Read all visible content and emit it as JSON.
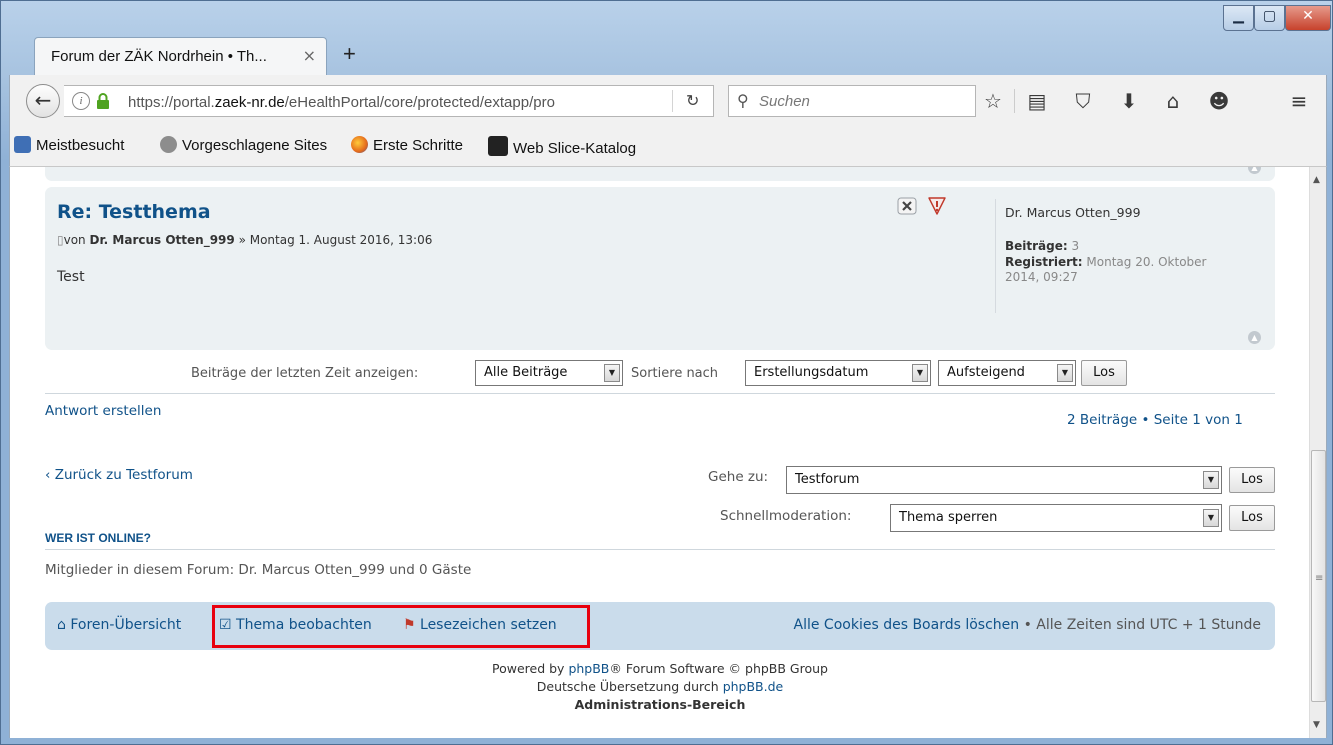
{
  "browser": {
    "tab_title": "Forum der ZÄK Nordrhein • Th...",
    "tab_close": "×",
    "new_tab": "+",
    "url_prefix": "https://portal.",
    "url_domain": "zaek-nr.de",
    "url_path": "/eHealthPortal/core/protected/extapp/pro",
    "search_placeholder": "Suchen",
    "window_buttons": {
      "minimize": "▁",
      "maximize": "▢",
      "close": "✕"
    }
  },
  "bookmarks": [
    {
      "label": "Meistbesucht",
      "icon": "most-visited-icon",
      "color": "#3f6fb5"
    },
    {
      "label": "Vorgeschlagene Sites",
      "icon": "globe-icon",
      "color": "#6d6d6d"
    },
    {
      "label": "Erste Schritte",
      "icon": "firefox-icon",
      "color": "#e56a1b"
    },
    {
      "label": "Web Slice-Katalog",
      "icon": "web-slice-icon",
      "color": "#222222"
    }
  ],
  "post": {
    "title": "Re: Testthema",
    "meta_prefix": "von",
    "author": "Dr. Marcus Otten_999",
    "meta_suffix": " » Montag 1. August 2016, 13:06",
    "body": "Test",
    "profile": {
      "name": "Dr. Marcus Otten_999",
      "posts_label": "Beiträge:",
      "posts_value": "3",
      "registered_label": "Registriert:",
      "registered_value": "Montag 20. Oktober",
      "registered_value_2": "2014, 09:27"
    }
  },
  "sort": {
    "label_days": "Beiträge der letzten Zeit anzeigen:",
    "days_value": "Alle Beiträge",
    "label_sort": "Sortiere nach",
    "sort_value": "Erstellungsdatum",
    "order_value": "Aufsteigend",
    "go_label": "Los"
  },
  "actions": {
    "reply": "Antwort erstellen",
    "pagination": "2 Beiträge • Seite 1 von 1",
    "back_arrow": "‹",
    "back": "Zurück zu Testforum",
    "jump_label": "Gehe zu:",
    "jump_value": "Testforum",
    "jump_go": "Los",
    "quickmod_label": "Schnellmoderation:",
    "quickmod_value": "Thema sperren",
    "quickmod_go": "Los"
  },
  "online": {
    "heading": "WER IST ONLINE?",
    "text": "Mitglieder in diesem Forum: Dr. Marcus Otten_999 und 0 Gäste"
  },
  "footer": {
    "index": "Foren-Übersicht",
    "watch": "Thema beobachten",
    "bookmark": "Lesezeichen setzen",
    "delete_cookies": "Alle Cookies des Boards löschen",
    "timezone": " • Alle Zeiten sind UTC + 1 Stunde",
    "powered_prefix": "Powered by ",
    "powered_link": "phpBB",
    "powered_suffix": "® Forum Software © phpBB Group",
    "translation_prefix": "Deutsche Übersetzung durch ",
    "translation_link": "phpBB.de",
    "admin": "Administrations-Bereich"
  },
  "colors": {
    "highlight": "#e8000e",
    "link": "#105289",
    "panel": "#ecf1f3",
    "footer_panel": "#cadceb"
  }
}
